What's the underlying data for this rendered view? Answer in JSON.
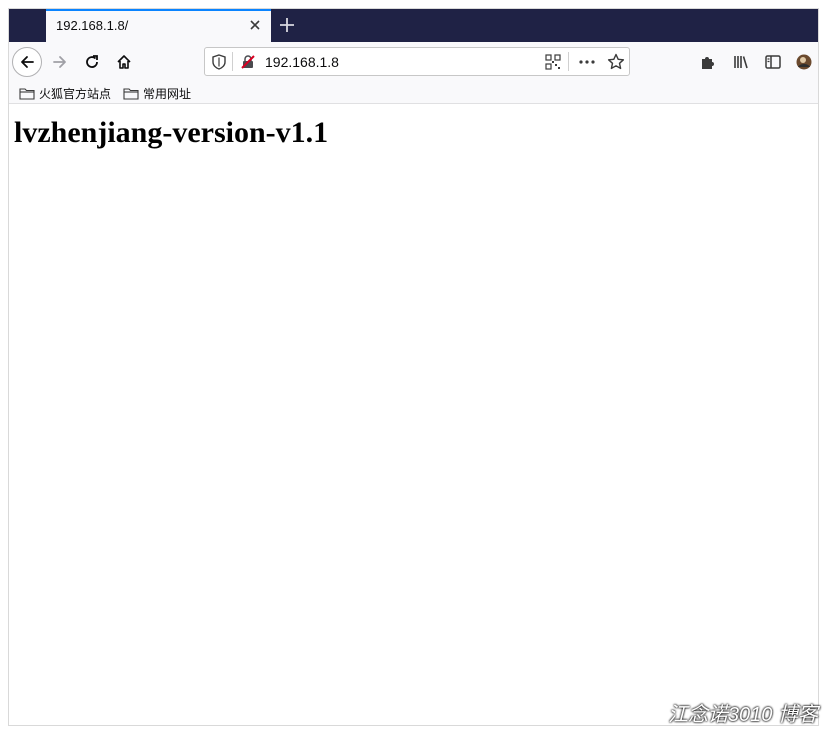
{
  "tab": {
    "title": "192.168.1.8/"
  },
  "urlbar": {
    "url": "192.168.1.8"
  },
  "bookmarks": [
    {
      "label": "火狐官方站点"
    },
    {
      "label": "常用网址"
    }
  ],
  "page": {
    "heading": "lvzhenjiang-version-v1.1"
  },
  "watermark": {
    "text": "江念诺3010 博客"
  },
  "colors": {
    "tabbar": "#1f2245",
    "accent": "#0a84ff",
    "toolbar": "#f9f9fb"
  }
}
